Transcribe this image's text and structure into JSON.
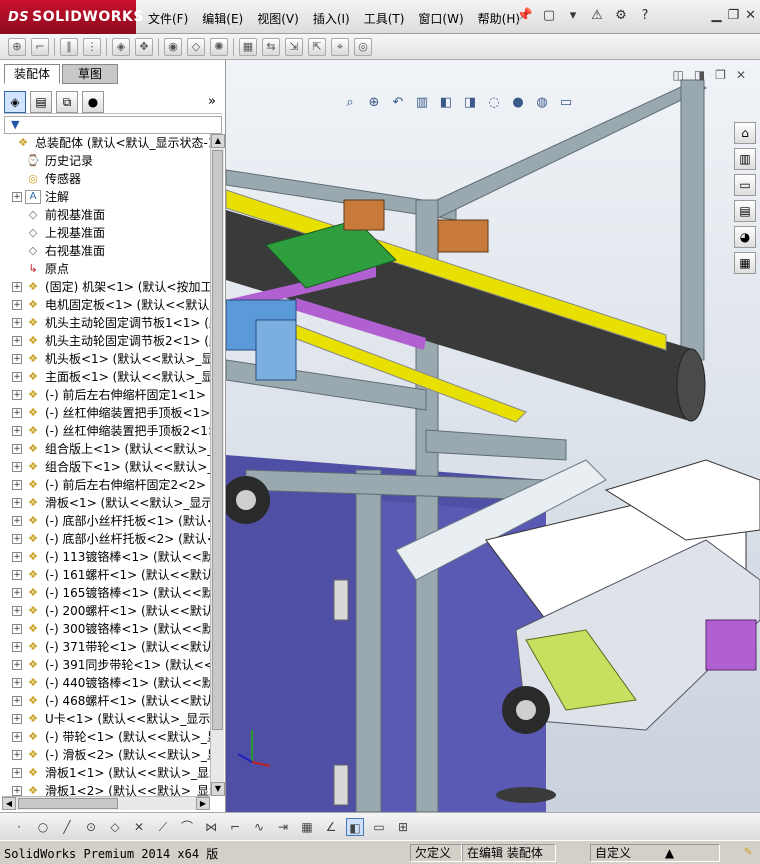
{
  "app": {
    "logo_ds": "DS",
    "logo_text": "SOLIDWORKS"
  },
  "menu": [
    "文件(F)",
    "编辑(E)",
    "视图(V)",
    "插入(I)",
    "工具(T)",
    "窗口(W)",
    "帮助(H)"
  ],
  "panel": {
    "tabs": [
      "装配体",
      "草图"
    ],
    "expand": "»",
    "filter_icon": "filter-icon"
  },
  "tree": [
    {
      "expand": "",
      "icon": "assembly-icon",
      "label": "总装配体  (默认<默认_显示状态-1"
    },
    {
      "expand": "",
      "icon": "history-icon",
      "label": "历史记录"
    },
    {
      "expand": "",
      "icon": "sensor-icon",
      "label": "传感器"
    },
    {
      "expand": "+",
      "icon": "annotation-icon",
      "label": "注解"
    },
    {
      "expand": "",
      "icon": "plane-icon",
      "label": "前视基准面"
    },
    {
      "expand": "",
      "icon": "plane-icon",
      "label": "上视基准面"
    },
    {
      "expand": "",
      "icon": "plane-icon",
      "label": "右视基准面"
    },
    {
      "expand": "",
      "icon": "origin-icon",
      "label": "原点"
    },
    {
      "expand": "+",
      "icon": "part-icon",
      "label": "(固定) 机架<1> (默认<按加工>"
    },
    {
      "expand": "+",
      "icon": "part-icon",
      "label": "电机固定板<1> (默认<<默认>_显"
    },
    {
      "expand": "+",
      "icon": "part-icon",
      "label": "机头主动轮固定调节板1<1>  (默"
    },
    {
      "expand": "+",
      "icon": "part-icon",
      "label": "机头主动轮固定调节板2<1>  (默"
    },
    {
      "expand": "+",
      "icon": "part-icon",
      "label": "机头板<1> (默认<<默认>_显示状"
    },
    {
      "expand": "+",
      "icon": "part-icon",
      "label": "主面板<1> (默认<<默认>_显示状"
    },
    {
      "expand": "+",
      "icon": "part-icon",
      "label": "(-) 前后左右伸缩杆固定1<1>  ("
    },
    {
      "expand": "+",
      "icon": "part-icon",
      "label": "(-) 丝杠伸缩装置把手顶板<1>"
    },
    {
      "expand": "+",
      "icon": "part-icon",
      "label": "(-) 丝杠伸缩装置把手顶板2<1>"
    },
    {
      "expand": "+",
      "icon": "part-icon",
      "label": "组合版上<1> (默认<<默认>_显示"
    },
    {
      "expand": "+",
      "icon": "part-icon",
      "label": "组合版下<1> (默认<<默认>_显示"
    },
    {
      "expand": "+",
      "icon": "part-icon",
      "label": "(-) 前后左右伸缩杆固定2<2>  ("
    },
    {
      "expand": "+",
      "icon": "part-icon",
      "label": "滑板<1> (默认<<默认>_显示状态"
    },
    {
      "expand": "+",
      "icon": "part-icon",
      "label": "(-) 底部小丝杆托板<1>  (默认<"
    },
    {
      "expand": "+",
      "icon": "part-icon",
      "label": "(-) 底部小丝杆托板<2>  (默认<"
    },
    {
      "expand": "+",
      "icon": "part-icon",
      "label": "(-) 113镀铬棒<1> (默认<<默认"
    },
    {
      "expand": "+",
      "icon": "part-icon",
      "label": "(-) 161螺杆<1> (默认<<默认>_"
    },
    {
      "expand": "+",
      "icon": "part-icon",
      "label": "(-) 165镀铬棒<1> (默认<<默认"
    },
    {
      "expand": "+",
      "icon": "part-icon",
      "label": "(-) 200螺杆<1> (默认<<默认>_"
    },
    {
      "expand": "+",
      "icon": "part-icon",
      "label": "(-) 300镀铬棒<1> (默认<<默认"
    },
    {
      "expand": "+",
      "icon": "part-icon",
      "label": "(-) 371带轮<1> (默认<<默认>_"
    },
    {
      "expand": "+",
      "icon": "part-icon",
      "label": "(-) 391同步带轮<1> (默认<<默"
    },
    {
      "expand": "+",
      "icon": "part-icon",
      "label": "(-) 440镀铬棒<1> (默认<<默认"
    },
    {
      "expand": "+",
      "icon": "part-icon",
      "label": "(-) 468螺杆<1> (默认<<默认>_"
    },
    {
      "expand": "+",
      "icon": "part-icon",
      "label": "U卡<1> (默认<<默认>_显示状态"
    },
    {
      "expand": "+",
      "icon": "part-icon",
      "label": "(-) 带轮<1> (默认<<默认>_显示"
    },
    {
      "expand": "+",
      "icon": "part-icon",
      "label": "(-) 滑板<2> (默认<<默认>_显示"
    },
    {
      "expand": "+",
      "icon": "part-icon",
      "label": "滑板1<1> (默认<<默认>_显示状"
    },
    {
      "expand": "+",
      "icon": "part-icon",
      "label": "滑板1<2> (默认<<默认>_显示状"
    }
  ],
  "status": {
    "version": "SolidWorks Premium 2014 x64 版",
    "defined": "欠定义",
    "editing": "在编辑 装配体",
    "custom": "自定义",
    "arrow": "▲"
  },
  "colors": {
    "accent": "#c8102e",
    "viewport_top": "#f0f3f7",
    "viewport_bottom": "#c9d2dd",
    "frame": "#9aa8b0",
    "belt": "#3a3a3a",
    "yellow_plate": "#e8e000",
    "purple_rod": "#b060d0",
    "green_plate": "#2e9e3e",
    "cabinet": "#5050a0"
  }
}
